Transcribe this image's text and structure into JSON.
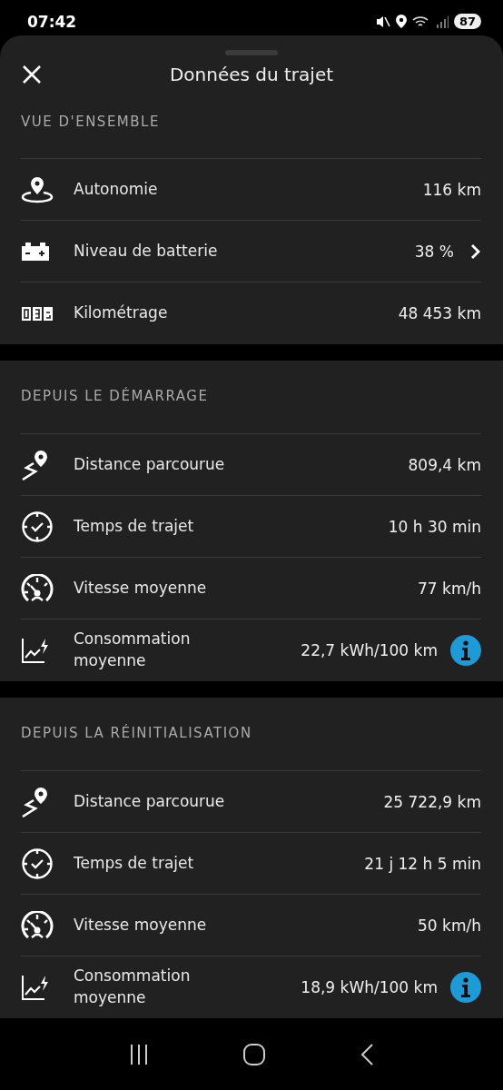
{
  "status_bar": {
    "time": "07:42",
    "battery": "87"
  },
  "header": {
    "title": "Données du trajet"
  },
  "sections": [
    {
      "title": "VUE D'ENSEMBLE",
      "rows": [
        {
          "kind": "location",
          "label": "Autonomie",
          "value": "116 km"
        },
        {
          "kind": "battery",
          "label": "Niveau de batterie",
          "value": "38 %"
        },
        {
          "kind": "odometer",
          "label": "Kilométrage",
          "value": "48 453 km"
        }
      ]
    },
    {
      "title": "DEPUIS LE DÉMARRAGE",
      "rows": [
        {
          "kind": "route",
          "label": "Distance parcourue",
          "value": "809,4 km"
        },
        {
          "kind": "clock",
          "label": "Temps de trajet",
          "value": "10 h 30 min"
        },
        {
          "kind": "speedometer",
          "label": "Vitesse moyenne",
          "value": "77 km/h"
        },
        {
          "kind": "chart",
          "label": "Consommation moyenne",
          "value": "22,7 kWh/100 km"
        }
      ]
    },
    {
      "title": "DEPUIS LA RÉINITIALISATION",
      "rows": [
        {
          "kind": "route",
          "label": "Distance parcourue",
          "value": "25 722,9 km"
        },
        {
          "kind": "clock",
          "label": "Temps de trajet",
          "value": "21 j 12 h 5 min"
        },
        {
          "kind": "speedometer",
          "label": "Vitesse moyenne",
          "value": "50 km/h"
        },
        {
          "kind": "chart",
          "label": "Consommation moyenne",
          "value": "18,9 kWh/100 km"
        }
      ]
    }
  ]
}
